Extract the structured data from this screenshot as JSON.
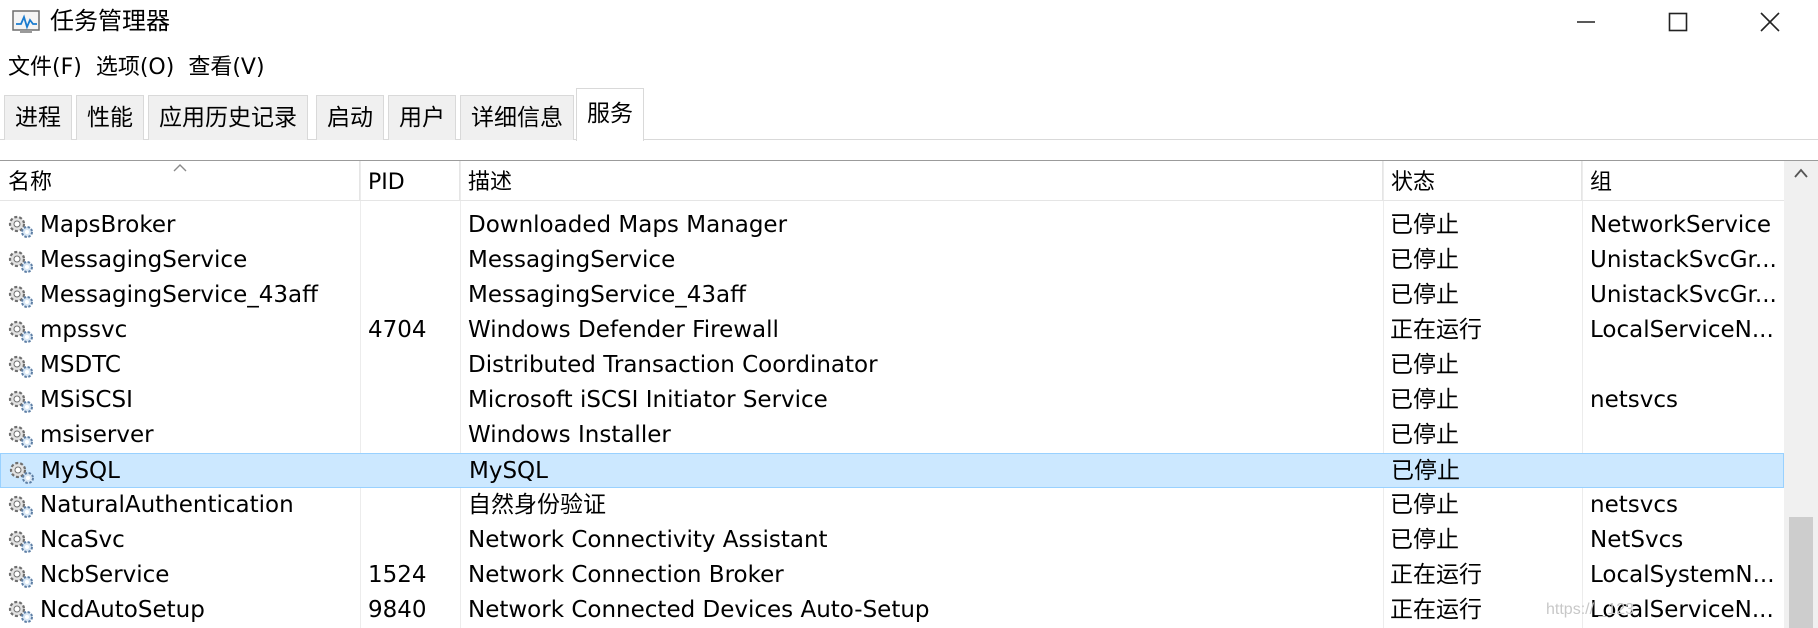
{
  "window": {
    "title": "任务管理器",
    "controls": {
      "minimize": "minimize-icon",
      "maximize": "maximize-icon",
      "close": "close-icon"
    }
  },
  "menu": [
    "文件(F)",
    "选项(O)",
    "查看(V)"
  ],
  "tabs": [
    "进程",
    "性能",
    "应用历史记录",
    "启动",
    "用户",
    "详细信息",
    "服务"
  ],
  "active_tab": "服务",
  "table": {
    "columns": [
      "名称",
      "PID",
      "描述",
      "状态",
      "组"
    ],
    "sort_column": "名称",
    "rows": [
      {
        "name": "MapsBroker",
        "pid": "",
        "desc": "Downloaded Maps Manager",
        "status": "已停止",
        "group": "NetworkService"
      },
      {
        "name": "MessagingService",
        "pid": "",
        "desc": "MessagingService",
        "status": "已停止",
        "group": "UnistackSvcGr..."
      },
      {
        "name": "MessagingService_43aff",
        "pid": "",
        "desc": "MessagingService_43aff",
        "status": "已停止",
        "group": "UnistackSvcGr..."
      },
      {
        "name": "mpssvc",
        "pid": "4704",
        "desc": "Windows Defender Firewall",
        "status": "正在运行",
        "group": "LocalServiceN..."
      },
      {
        "name": "MSDTC",
        "pid": "",
        "desc": "Distributed Transaction Coordinator",
        "status": "已停止",
        "group": ""
      },
      {
        "name": "MSiSCSI",
        "pid": "",
        "desc": "Microsoft iSCSI Initiator Service",
        "status": "已停止",
        "group": "netsvcs"
      },
      {
        "name": "msiserver",
        "pid": "",
        "desc": "Windows Installer",
        "status": "已停止",
        "group": ""
      },
      {
        "name": "MySQL",
        "pid": "",
        "desc": "MySQL",
        "status": "已停止",
        "group": ""
      },
      {
        "name": "NaturalAuthentication",
        "pid": "",
        "desc": "自然身份验证",
        "status": "已停止",
        "group": "netsvcs"
      },
      {
        "name": "NcaSvc",
        "pid": "",
        "desc": "Network Connectivity Assistant",
        "status": "已停止",
        "group": "NetSvcs"
      },
      {
        "name": "NcbService",
        "pid": "1524",
        "desc": "Network Connection Broker",
        "status": "正在运行",
        "group": "LocalSystemN..."
      },
      {
        "name": "NcdAutoSetup",
        "pid": "9840",
        "desc": "Network Connected Devices Auto-Setup",
        "status": "正在运行",
        "group": "LocalServiceN..."
      }
    ],
    "selected_row": "MySQL"
  },
  "annotation_color": "#e8262f",
  "selection_color": "#cce8ff",
  "watermark": "https://                             _123"
}
